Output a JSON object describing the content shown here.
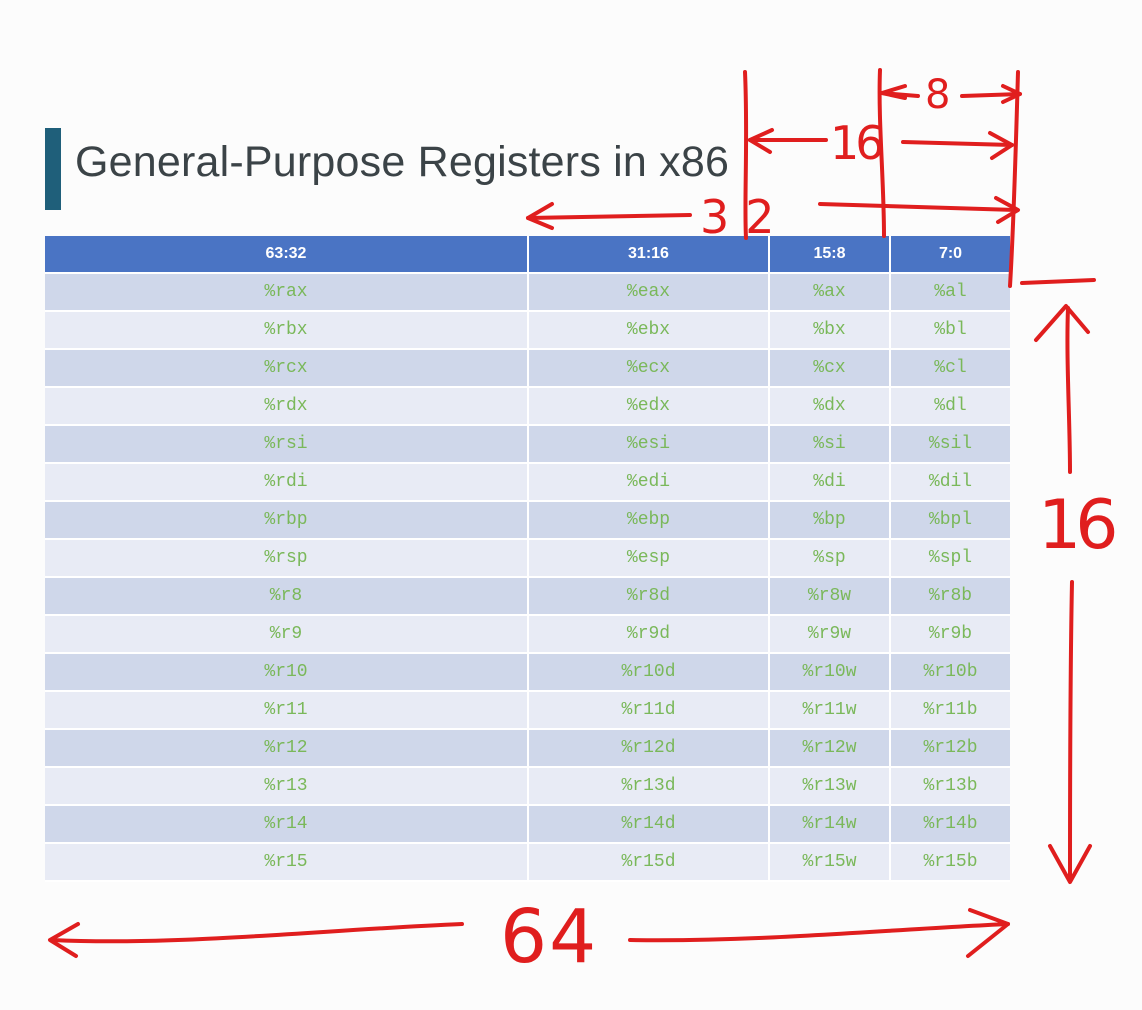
{
  "slide": {
    "title": "General-Purpose Registers in x86",
    "accent_color": "#1f5f7a"
  },
  "table": {
    "header_color": "#4a74c4",
    "register_text_color": "#7ab85a",
    "columns": [
      "63:32",
      "31:16",
      "15:8",
      "7:0"
    ],
    "rows": [
      [
        "%rax",
        "%eax",
        "%ax",
        "%al"
      ],
      [
        "%rbx",
        "%ebx",
        "%bx",
        "%bl"
      ],
      [
        "%rcx",
        "%ecx",
        "%cx",
        "%cl"
      ],
      [
        "%rdx",
        "%edx",
        "%dx",
        "%dl"
      ],
      [
        "%rsi",
        "%esi",
        "%si",
        "%sil"
      ],
      [
        "%rdi",
        "%edi",
        "%di",
        "%dil"
      ],
      [
        "%rbp",
        "%ebp",
        "%bp",
        "%bpl"
      ],
      [
        "%rsp",
        "%esp",
        "%sp",
        "%spl"
      ],
      [
        "%r8",
        "%r8d",
        "%r8w",
        "%r8b"
      ],
      [
        "%r9",
        "%r9d",
        "%r9w",
        "%r9b"
      ],
      [
        "%r10",
        "%r10d",
        "%r10w",
        "%r10b"
      ],
      [
        "%r11",
        "%r11d",
        "%r11w",
        "%r11b"
      ],
      [
        "%r12",
        "%r12d",
        "%r12w",
        "%r12b"
      ],
      [
        "%r13",
        "%r13d",
        "%r13w",
        "%r13b"
      ],
      [
        "%r14",
        "%r14d",
        "%r14w",
        "%r14b"
      ],
      [
        "%r15",
        "%r15d",
        "%r15w",
        "%r15b"
      ]
    ]
  },
  "annotations": {
    "ink_color": "#e01e1e",
    "width_8": "8",
    "width_16": "16",
    "width_32": "32",
    "register_count": "16",
    "width_64": "64"
  }
}
